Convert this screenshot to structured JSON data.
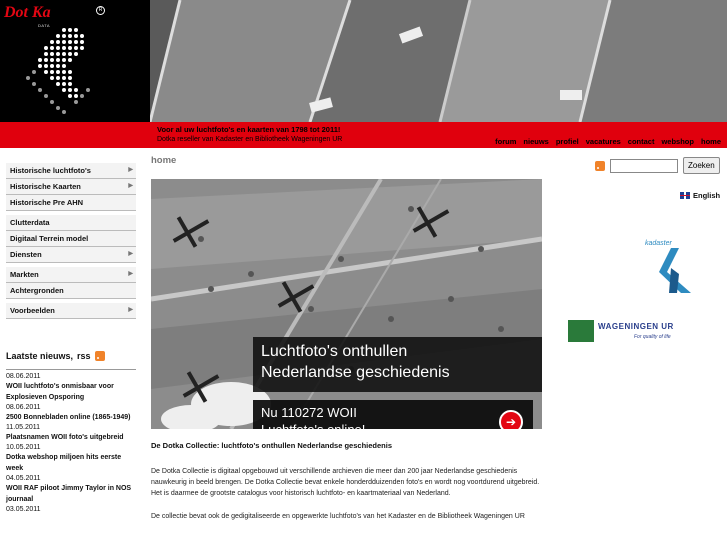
{
  "header": {
    "logo_main": "Dot Ka",
    "logo_sub": "DATA",
    "tagline1": "Voor al uw luchtfoto's en kaarten van 1798 tot 2011!",
    "tagline2": "Dotka reseller van Kadaster en Bibliotheek Wageningen UR",
    "nav": [
      "forum",
      "nieuws",
      "profiel",
      "vacatures",
      "contact",
      "webshop",
      "home"
    ]
  },
  "sidebar": {
    "menu": [
      {
        "label": "Historische luchtfoto's",
        "arrow": true
      },
      {
        "label": "Historische Kaarten",
        "arrow": true
      },
      {
        "label": "Historische Pre AHN",
        "arrow": false
      },
      {
        "gap": true
      },
      {
        "label": "Clutterdata",
        "arrow": false
      },
      {
        "label": "Digitaal Terrein model",
        "arrow": false
      },
      {
        "label": "Diensten",
        "arrow": true
      },
      {
        "gap": true
      },
      {
        "label": "Markten",
        "arrow": true
      },
      {
        "label": "Achtergronden",
        "arrow": false
      },
      {
        "gap": true
      },
      {
        "label": "Voorbeelden",
        "arrow": true
      }
    ],
    "news_heading": "Laatste nieuws,",
    "news_rss": "rss",
    "news": [
      {
        "date": "08.06.2011",
        "title": "WOII luchtfoto's onmisbaar voor Explosieven Opsporing"
      },
      {
        "date": "08.06.2011",
        "title": "2500 Bonnebladen online (1865-1949)"
      },
      {
        "date": "11.05.2011",
        "title": "Plaatsnamen WOII foto's uitgebreid"
      },
      {
        "date": "10.05.2011",
        "title": "Dotka webshop miljoen hits eerste week"
      },
      {
        "date": "04.05.2011",
        "title": "WOII RAF piloot Jimmy Taylor in NOS journaal"
      },
      {
        "date": "03.05.2011",
        "title": ""
      }
    ]
  },
  "main": {
    "breadcrumb": "home",
    "hero_line1": "Luchtfoto's onthullen",
    "hero_line2": "Nederlandse geschiedenis",
    "hero_cta1": "Nu 110272 WOII",
    "hero_cta2": "Luchtfoto's online!",
    "article_title": "De Dotka Collectie: luchtfoto's onthullen Nederlandse geschiedenis",
    "article_p1": "De Dotka Collectie is digitaal opgebouwd uit verschillende archieven die meer dan 200 jaar Nederlandse geschiedenis nauwkeurig in beeld brengen. De Dotka Collectie bevat enkele honderdduizenden foto's en wordt nog voortdurend uitgebreid. Het is daarmee de grootste catalogus voor historisch luchtfoto- en kaartmateriaal van Nederland.",
    "article_p2": "De collectie bevat ook de gedigitaliseerde en opgewerkte luchtfoto's van het Kadaster en de Bibliotheek Wageningen UR"
  },
  "right": {
    "search_button": "Zoeken",
    "search_value": "",
    "language": "English",
    "kadaster": "kadaster",
    "wur_name": "WAGENINGEN UR",
    "wur_tagline": "For quality of life"
  },
  "colors": {
    "brand_red": "#e0000d",
    "wur_green": "#2a7a3a",
    "kadaster_blue": "#2e8bc0"
  }
}
